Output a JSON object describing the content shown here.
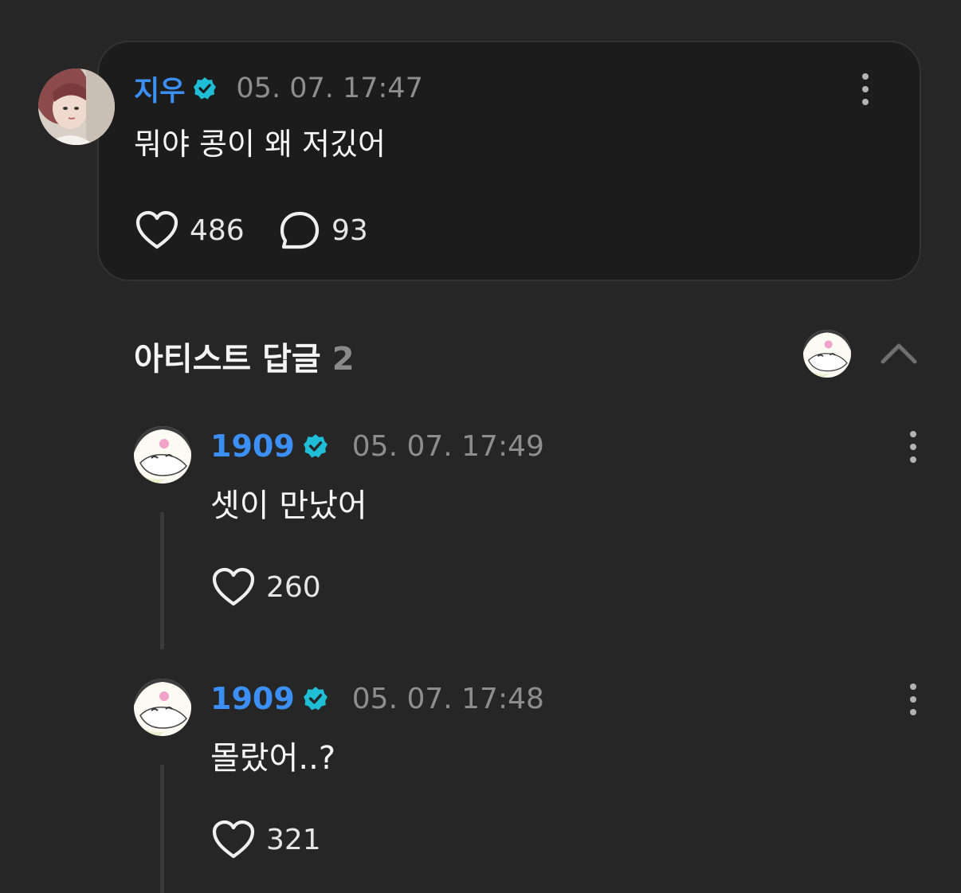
{
  "post": {
    "author": "지우",
    "timestamp": "05. 07. 17:47",
    "text": "뭐야 콩이 왜 저깄어",
    "likes": "486",
    "comments": "93"
  },
  "replies_section": {
    "title": "아티스트 답글",
    "count": "2"
  },
  "replies": [
    {
      "author": "1909",
      "timestamp": "05. 07. 17:49",
      "text": "셋이 만났어",
      "likes": "260"
    },
    {
      "author": "1909",
      "timestamp": "05. 07. 17:48",
      "text": "몰랐어..?",
      "likes": "321"
    }
  ],
  "colors": {
    "background": "#262626",
    "card": "#1c1c1c",
    "name_accent": "#3b8ff5",
    "verified_badge": "#1fbdd6",
    "timestamp": "#8e8e8e"
  },
  "icons": {
    "verified": "verified-badge-icon",
    "like": "heart-icon",
    "comment": "comment-bubble-icon",
    "more": "more-vertical-icon",
    "collapse": "chevron-up-icon"
  }
}
